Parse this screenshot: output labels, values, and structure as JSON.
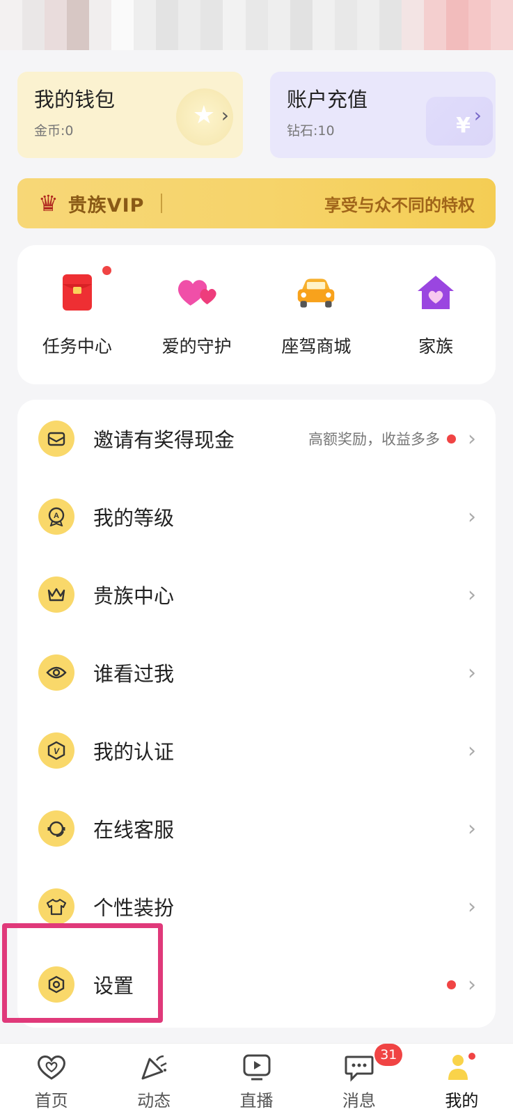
{
  "wallet": {
    "title": "我的钱包",
    "sub": "金币:0"
  },
  "recharge": {
    "title": "账户充值",
    "sub": "钻石:10"
  },
  "vip": {
    "title": "贵族VIP",
    "tagline": "享受与众不同的特权"
  },
  "features": [
    {
      "label": "任务中心",
      "icon": "red-envelope-icon"
    },
    {
      "label": "爱的守护",
      "icon": "hearts-icon"
    },
    {
      "label": "座驾商城",
      "icon": "car-icon"
    },
    {
      "label": "家族",
      "icon": "house-icon"
    }
  ],
  "menu": [
    {
      "label": "邀请有奖得现金",
      "extra": "高额奖励，收益多多",
      "icon": "invite-icon"
    },
    {
      "label": "我的等级",
      "icon": "level-badge-icon"
    },
    {
      "label": "贵族中心",
      "icon": "crown-icon"
    },
    {
      "label": "谁看过我",
      "icon": "eye-icon"
    },
    {
      "label": "我的认证",
      "icon": "verify-icon"
    },
    {
      "label": "在线客服",
      "icon": "headset-icon"
    },
    {
      "label": "个性装扮",
      "icon": "shirt-icon"
    },
    {
      "label": "设置",
      "icon": "settings-icon"
    }
  ],
  "tabs": [
    {
      "label": "首页",
      "icon": "heart-icon"
    },
    {
      "label": "动态",
      "icon": "party-popper-icon"
    },
    {
      "label": "直播",
      "icon": "tv-play-icon"
    },
    {
      "label": "消息",
      "icon": "chat-icon",
      "badge": "31"
    },
    {
      "label": "我的",
      "icon": "profile-icon"
    }
  ],
  "colors": {
    "accent": "#f9d86a",
    "red": "#f04444",
    "highlight": "#e0397a"
  }
}
